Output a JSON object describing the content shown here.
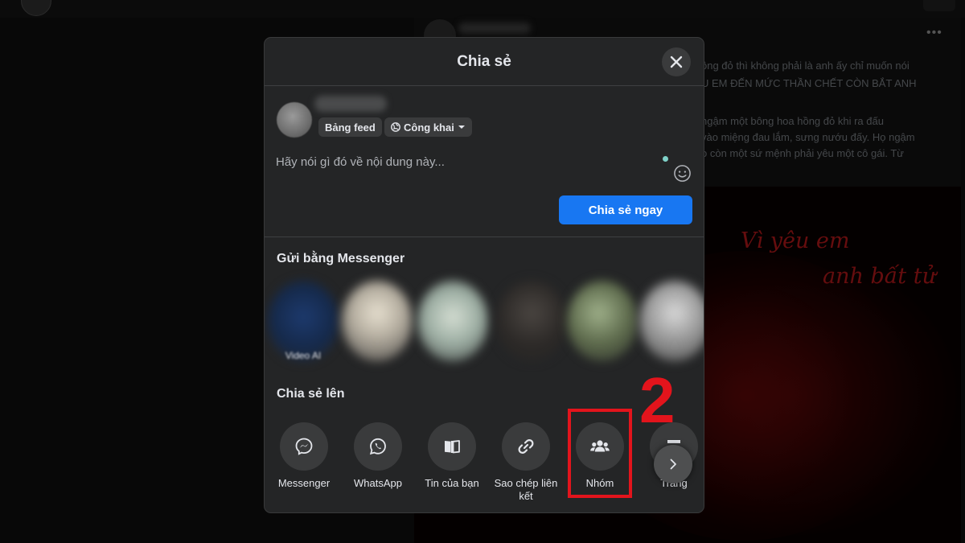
{
  "background": {
    "post_text_lines": [
      "ồng đỏ thì không phải là anh ấy chỉ muốn nói",
      "U EM ĐẾN MỨC THẦN CHẾT CÒN BẮT ANH",
      "ngậm một bông hoa hồng đỏ khi ra đấu",
      "vào miệng đau lắm, sưng nướu đấy. Họ ngậm",
      "o còn một sứ mệnh phải yêu một cô gái.  Từ"
    ],
    "image_script": [
      "Vì yêu em",
      "anh bất tử"
    ],
    "more_icon": "more-dots-icon"
  },
  "dialog": {
    "title": "Chia sẻ",
    "close_icon": "close-icon",
    "composer": {
      "feed_chip": "Bảng feed",
      "audience_chip": "Công khai",
      "audience_icon": "globe-icon",
      "placeholder": "Hãy nói gì đó về nội dung này...",
      "emoji_icon": "smiley-icon",
      "share_now_label": "Chia sẻ ngay"
    },
    "messenger_section_title": "Gửi bằng Messenger",
    "contacts": [
      {
        "label": "Video AI",
        "color": "#1d3a6e"
      },
      {
        "label": "",
        "color": "#c8c2b4"
      },
      {
        "label": "",
        "color": "#b9c6bd"
      },
      {
        "label": "",
        "color": "#2e2b29"
      },
      {
        "label": "",
        "color": "#6e7a58"
      },
      {
        "label": "",
        "color": "#9a9a9a"
      }
    ],
    "share_to_section_title": "Chia sẻ lên",
    "share_options": [
      {
        "label": "Messenger",
        "icon": "messenger-icon"
      },
      {
        "label": "WhatsApp",
        "icon": "whatsapp-icon"
      },
      {
        "label": "Tin của bạn",
        "icon": "story-book-icon"
      },
      {
        "label": "Sao chép liên kết",
        "icon": "link-icon"
      },
      {
        "label": "Nhóm",
        "icon": "group-icon"
      },
      {
        "label": "Trang",
        "icon": "page-flag-icon"
      }
    ],
    "next_icon": "chevron-right-icon"
  },
  "annotation": {
    "step_number": "2",
    "color": "#e3141c"
  },
  "colors": {
    "primary": "#1877f2",
    "dialog_bg": "#242526",
    "control_bg": "#3a3b3c"
  }
}
